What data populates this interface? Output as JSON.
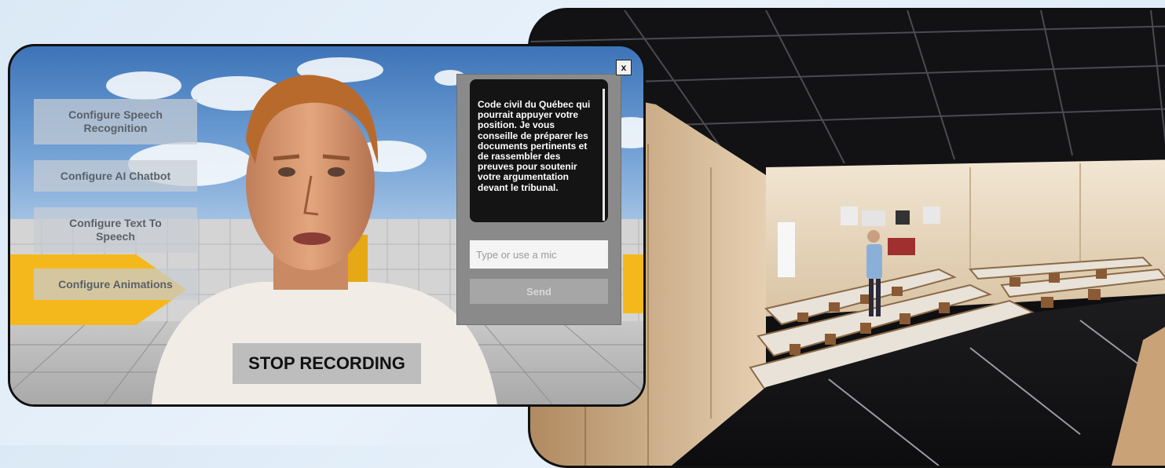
{
  "menu": {
    "speech_recognition": "Configure Speech\nRecognition",
    "ai_chatbot": "Configure AI Chatbot",
    "text_to_speech": "Configure Text To\nSpeech",
    "animations": "Configure Animations"
  },
  "recording": {
    "stop_label": "STOP RECORDING"
  },
  "chat": {
    "close_label": "x",
    "message": "Code civil du Québec qui pourrait appuyer votre position. Je vous conseille de préparer les documents pertinents et de rassembler des preuves pour soutenir votre argumentation devant le tribunal.",
    "input_placeholder": "Type or use a mic",
    "send_label": "Send"
  },
  "colors": {
    "accent_yellow": "#f5b81c",
    "chat_bg": "#141414",
    "panel_gray": "#8a8a8a"
  }
}
